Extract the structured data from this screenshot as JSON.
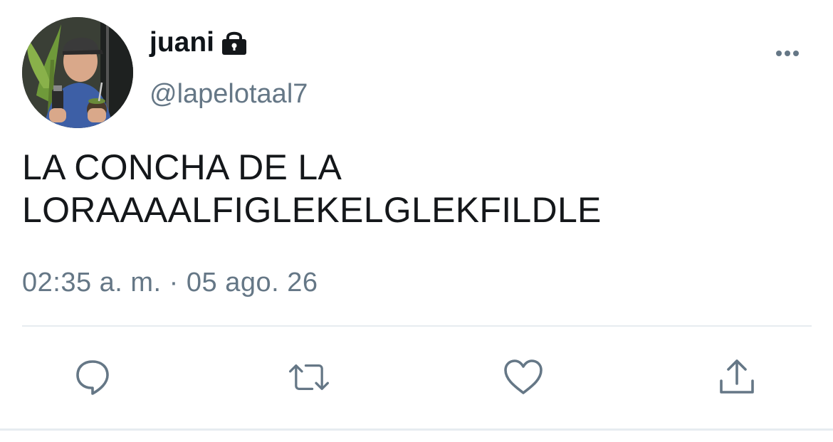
{
  "tweet": {
    "display_name": "juani",
    "handle": "@lapelotaal7",
    "text_lines": [
      "LA CONCHA DE LA",
      "LORAAAALFIGLEKELGLEKFILDLE"
    ],
    "timestamp": "02:35 a. m. · 05 ago. 26",
    "locked": true
  },
  "icons": {
    "avatar": "profile-photo",
    "lock": "lock-icon",
    "more": "more-horizontal-icon",
    "reply": "reply-icon",
    "retweet": "retweet-icon",
    "like": "heart-icon",
    "share": "share-icon"
  },
  "colors": {
    "text": "#14171a",
    "secondary": "#657786",
    "icon": "#657786",
    "divider": "#e6ecf0"
  }
}
